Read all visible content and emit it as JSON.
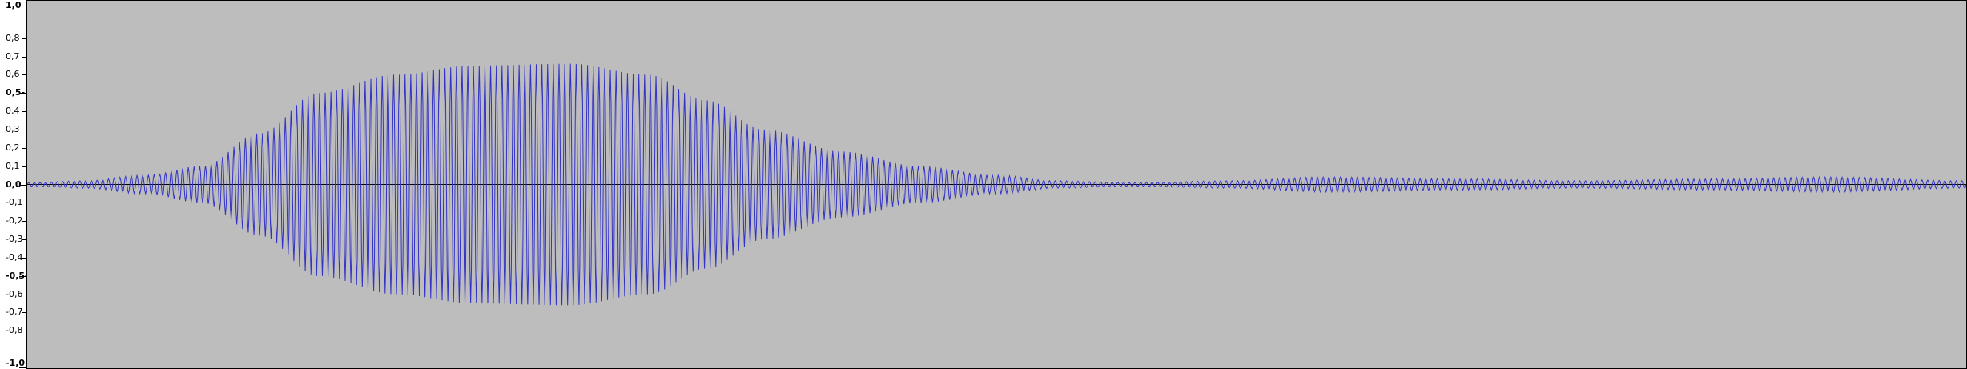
{
  "colors": {
    "track_background": "#bdbdbd",
    "waveform": "#3232c8",
    "zero_line": "#000000",
    "ruler_background": "#ffffff",
    "ruler_text": "#000000"
  },
  "ruler": {
    "range": [
      -1.0,
      1.0
    ],
    "labels": [
      {
        "text": "1,0",
        "value": 1.0,
        "bold": true
      },
      {
        "text": "0,8",
        "value": 0.8,
        "bold": false
      },
      {
        "text": "0,7",
        "value": 0.7,
        "bold": false
      },
      {
        "text": "0,6",
        "value": 0.6,
        "bold": false
      },
      {
        "text": "0,5-",
        "value": 0.5,
        "bold": true
      },
      {
        "text": "0,4",
        "value": 0.4,
        "bold": false
      },
      {
        "text": "0,3",
        "value": 0.3,
        "bold": false
      },
      {
        "text": "0,2",
        "value": 0.2,
        "bold": false
      },
      {
        "text": "0,1",
        "value": 0.1,
        "bold": false
      },
      {
        "text": "0,0",
        "value": 0.0,
        "bold": true
      },
      {
        "text": "-0,1",
        "value": -0.1,
        "bold": false
      },
      {
        "text": "-0,2",
        "value": -0.2,
        "bold": false
      },
      {
        "text": "-0,3",
        "value": -0.3,
        "bold": false
      },
      {
        "text": "-0,4",
        "value": -0.4,
        "bold": false
      },
      {
        "text": "-0,5-",
        "value": -0.5,
        "bold": true
      },
      {
        "text": "-0,6",
        "value": -0.6,
        "bold": false
      },
      {
        "text": "-0,7",
        "value": -0.7,
        "bold": false
      },
      {
        "text": "-0,8",
        "value": -0.8,
        "bold": false
      },
      {
        "text": "-1,0",
        "value": -1.0,
        "bold": true
      }
    ]
  },
  "waveform": {
    "description_free_envelope": [
      {
        "t": 0.0,
        "a": 0.01
      },
      {
        "t": 0.03,
        "a": 0.02
      },
      {
        "t": 0.06,
        "a": 0.05
      },
      {
        "t": 0.09,
        "a": 0.1
      },
      {
        "t": 0.12,
        "a": 0.28
      },
      {
        "t": 0.15,
        "a": 0.5
      },
      {
        "t": 0.19,
        "a": 0.6
      },
      {
        "t": 0.23,
        "a": 0.65
      },
      {
        "t": 0.28,
        "a": 0.66
      },
      {
        "t": 0.32,
        "a": 0.6
      },
      {
        "t": 0.35,
        "a": 0.46
      },
      {
        "t": 0.38,
        "a": 0.3
      },
      {
        "t": 0.42,
        "a": 0.18
      },
      {
        "t": 0.46,
        "a": 0.1
      },
      {
        "t": 0.5,
        "a": 0.05
      },
      {
        "t": 0.53,
        "a": 0.02
      },
      {
        "t": 0.57,
        "a": 0.01
      },
      {
        "t": 0.62,
        "a": 0.02
      },
      {
        "t": 0.67,
        "a": 0.04
      },
      {
        "t": 0.74,
        "a": 0.03
      },
      {
        "t": 0.8,
        "a": 0.02
      },
      {
        "t": 0.87,
        "a": 0.03
      },
      {
        "t": 0.93,
        "a": 0.04
      },
      {
        "t": 1.0,
        "a": 0.02
      }
    ],
    "cycles": 340
  }
}
